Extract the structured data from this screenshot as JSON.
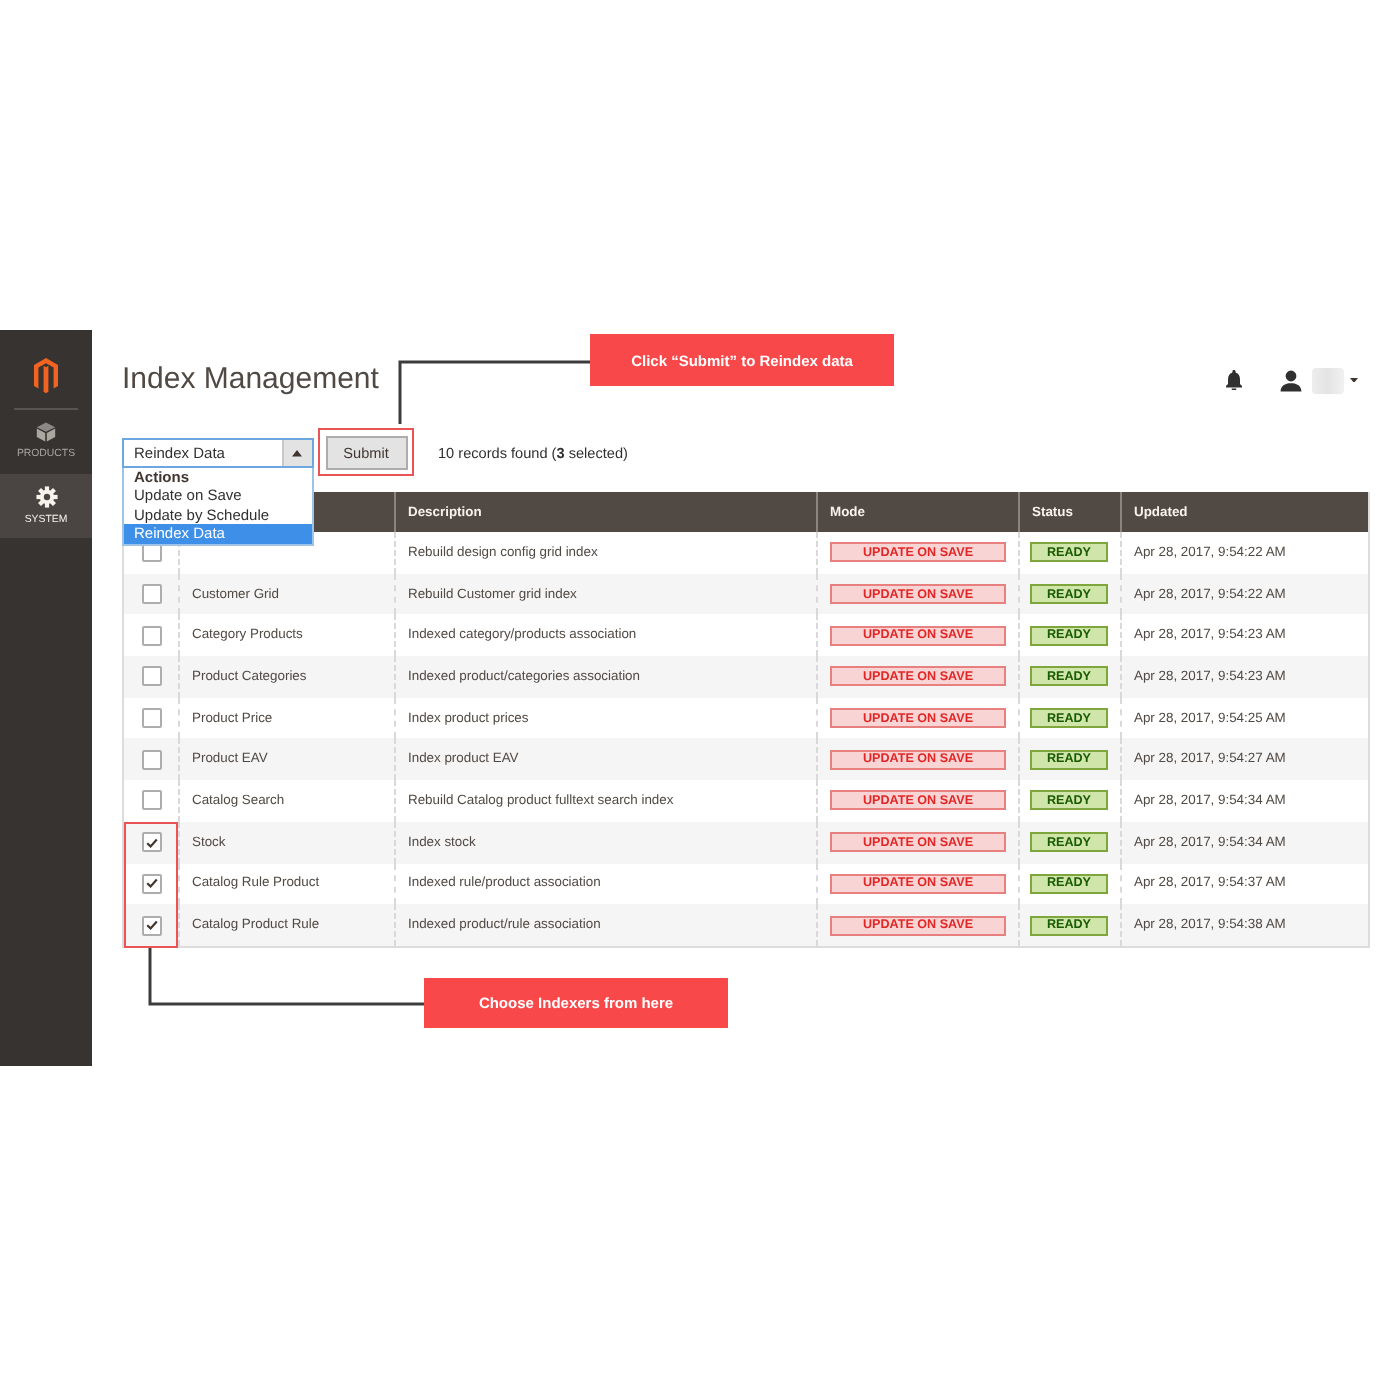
{
  "sidebar": {
    "items": [
      {
        "label": "PRODUCTS",
        "selected": false
      },
      {
        "label": "SYSTEM",
        "selected": true
      }
    ]
  },
  "header": {
    "title": "Index Management"
  },
  "toolbar": {
    "action_select": {
      "value": "Reindex Data",
      "expanded": true,
      "options": [
        {
          "label": "Actions",
          "kind": "group",
          "selected": false
        },
        {
          "label": "Update on Save",
          "kind": "option",
          "selected": false
        },
        {
          "label": "Update by Schedule",
          "kind": "option",
          "selected": false
        },
        {
          "label": "Reindex Data",
          "kind": "option",
          "selected": true
        }
      ]
    },
    "submit_label": "Submit",
    "records_text": "10 records found (**3** selected)"
  },
  "table": {
    "columns": [
      "Description",
      "Mode",
      "Status",
      "Updated"
    ],
    "rows": [
      {
        "checked": false,
        "description": "Rebuild design config grid index",
        "mode": "UPDATE ON SAVE",
        "status": "READY",
        "updated": "Apr 28, 2017, 9:54:22 AM"
      },
      {
        "checked": false,
        "indexer": "Customer Grid",
        "description": "Rebuild Customer grid index",
        "mode": "UPDATE ON SAVE",
        "status": "READY",
        "updated": "Apr 28, 2017, 9:54:22 AM"
      },
      {
        "checked": false,
        "indexer": "Category Products",
        "description": "Indexed category/products association",
        "mode": "UPDATE ON SAVE",
        "status": "READY",
        "updated": "Apr 28, 2017, 9:54:23 AM"
      },
      {
        "checked": false,
        "indexer": "Product Categories",
        "description": "Indexed product/categories association",
        "mode": "UPDATE ON SAVE",
        "status": "READY",
        "updated": "Apr 28, 2017, 9:54:23 AM"
      },
      {
        "checked": false,
        "indexer": "Product Price",
        "description": "Index product prices",
        "mode": "UPDATE ON SAVE",
        "status": "READY",
        "updated": "Apr 28, 2017, 9:54:25 AM"
      },
      {
        "checked": false,
        "indexer": "Product EAV",
        "description": "Index product EAV",
        "mode": "UPDATE ON SAVE",
        "status": "READY",
        "updated": "Apr 28, 2017, 9:54:27 AM"
      },
      {
        "checked": false,
        "indexer": "Catalog Search",
        "description": "Rebuild Catalog product fulltext search index",
        "mode": "UPDATE ON SAVE",
        "status": "READY",
        "updated": "Apr 28, 2017, 9:54:34 AM"
      },
      {
        "checked": true,
        "indexer": "Stock",
        "description": "Index stock",
        "mode": "UPDATE ON SAVE",
        "status": "READY",
        "updated": "Apr 28, 2017, 9:54:34 AM"
      },
      {
        "checked": true,
        "indexer": "Catalog Rule Product",
        "description": "Indexed rule/product association",
        "mode": "UPDATE ON SAVE",
        "status": "READY",
        "updated": "Apr 28, 2017, 9:54:37 AM"
      },
      {
        "checked": true,
        "indexer": "Catalog Product Rule",
        "description": "Indexed product/rule association",
        "mode": "UPDATE ON SAVE",
        "status": "READY",
        "updated": "Apr 28, 2017, 9:54:38 AM"
      }
    ]
  },
  "callouts": [
    {
      "text": "Click “Submit” to Reindex data"
    },
    {
      "text": "Choose Indexers from here"
    }
  ]
}
